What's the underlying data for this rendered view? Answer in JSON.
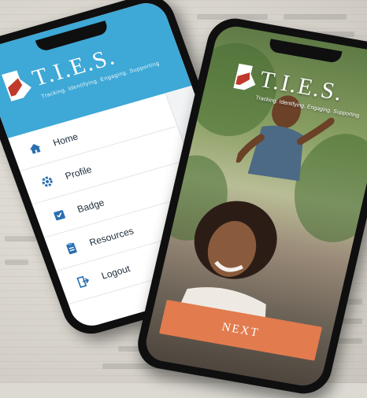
{
  "brand": {
    "name": "T.I.E.S.",
    "tagline": "Tracking. Identifying. Engaging. Supporting"
  },
  "menu": {
    "items": [
      {
        "label": "Home",
        "icon": "home-icon"
      },
      {
        "label": "Profile",
        "icon": "gear-icon"
      },
      {
        "label": "Badge",
        "icon": "badge-icon"
      },
      {
        "label": "Resources",
        "icon": "resources-icon"
      },
      {
        "label": "Logout",
        "icon": "logout-icon"
      }
    ]
  },
  "onboarding": {
    "next_label": "NEXT"
  },
  "colors": {
    "header_blue": "#3ea8d6",
    "next_orange": "#e27b4e",
    "icon_blue": "#2a6fb0",
    "logo_red": "#c0392b"
  }
}
